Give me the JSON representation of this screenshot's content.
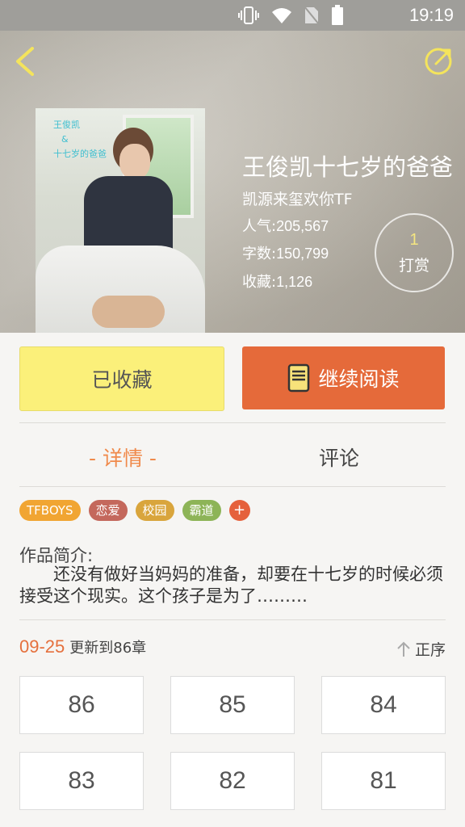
{
  "status_bar": {
    "time": "19:19"
  },
  "book": {
    "title": "王俊凯十七岁的爸爸",
    "author": "凯源来玺欢你TF",
    "stats": [
      {
        "label": "人气:",
        "value": "205,567"
      },
      {
        "label": "字数:",
        "value": "150,799"
      },
      {
        "label": "收藏:",
        "value": "1,126"
      }
    ],
    "cover_caption": [
      "王俊凯",
      "&",
      "十七岁的爸爸"
    ]
  },
  "tip": {
    "count": "1",
    "label": "打赏"
  },
  "actions": {
    "favorite": "已收藏",
    "read": "继续阅读"
  },
  "tabs": {
    "detail": "- 详情 -",
    "comment": "评论"
  },
  "tags": [
    {
      "label": "TFBOYS",
      "color": "#f1a532"
    },
    {
      "label": "恋爱",
      "color": "#c4685c"
    },
    {
      "label": "校园",
      "color": "#d9a53c"
    },
    {
      "label": "霸道",
      "color": "#8db457"
    }
  ],
  "tag_more": "+",
  "intro": {
    "label": "作品简介:",
    "text": "还没有做好当妈妈的准备，却要在十七岁的时候必须接受这个现实。这个孩子是为了………"
  },
  "update": {
    "date": "09-25",
    "text": "更新到86章",
    "sort_label": "正序"
  },
  "chapters": [
    "86",
    "85",
    "84",
    "83",
    "82",
    "81"
  ],
  "colors": {
    "accent": "#e56a3a",
    "favorite": "#fbf07a",
    "tab_active": "#f08a4b"
  }
}
